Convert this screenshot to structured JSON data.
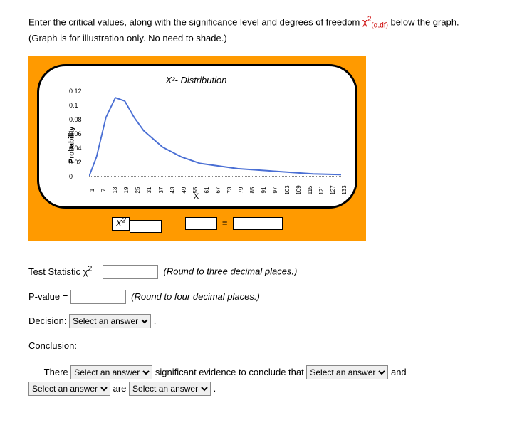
{
  "prompt_before": "Enter the critical values, along with the significance level and degrees of freedom ",
  "prompt_chi": "χ",
  "prompt_sup": "2",
  "prompt_sub": "(α,df)",
  "prompt_after": " below the graph. (Graph is for illustration only. No need to shade.)",
  "chart": {
    "title": "X²- Distribution",
    "ylabel": "Probability",
    "xlabel": "X",
    "yticks": [
      "0.12",
      "0.1",
      "0.08",
      "0.06",
      "0.04",
      "0.02",
      "0"
    ],
    "xticks": [
      "1",
      "7",
      "13",
      "19",
      "25",
      "31",
      "37",
      "43",
      "49",
      "55",
      "61",
      "67",
      "73",
      "79",
      "85",
      "91",
      "97",
      "103",
      "109",
      "115",
      "121",
      "127",
      "133"
    ]
  },
  "fill": {
    "chi_label_x": "X",
    "chi_label_sup": "2",
    "eq": "="
  },
  "q": {
    "ts_label": "Test Statistic χ",
    "ts_sup": "2",
    "ts_eq": " = ",
    "ts_note": "(Round to three decimal places.)",
    "p_label": "P-value = ",
    "p_note": "(Round to four decimal places.)",
    "dec_label": "Decision: ",
    "period": ".",
    "conc_label": "Conclusion:",
    "there": "There ",
    "sig": " significant evidence to conclude that ",
    "and": " and ",
    "are": " are ",
    "select_placeholder": "Select an answer"
  },
  "chart_data": {
    "type": "line",
    "title": "X²- Distribution",
    "xlabel": "X",
    "ylabel": "Probability",
    "ylim": [
      0,
      0.13
    ],
    "xlim": [
      1,
      135
    ],
    "x": [
      1,
      5,
      10,
      15,
      20,
      25,
      30,
      40,
      50,
      60,
      80,
      100,
      120,
      135
    ],
    "y": [
      0.0,
      0.03,
      0.09,
      0.12,
      0.115,
      0.09,
      0.07,
      0.045,
      0.03,
      0.02,
      0.012,
      0.008,
      0.004,
      0.003
    ]
  }
}
